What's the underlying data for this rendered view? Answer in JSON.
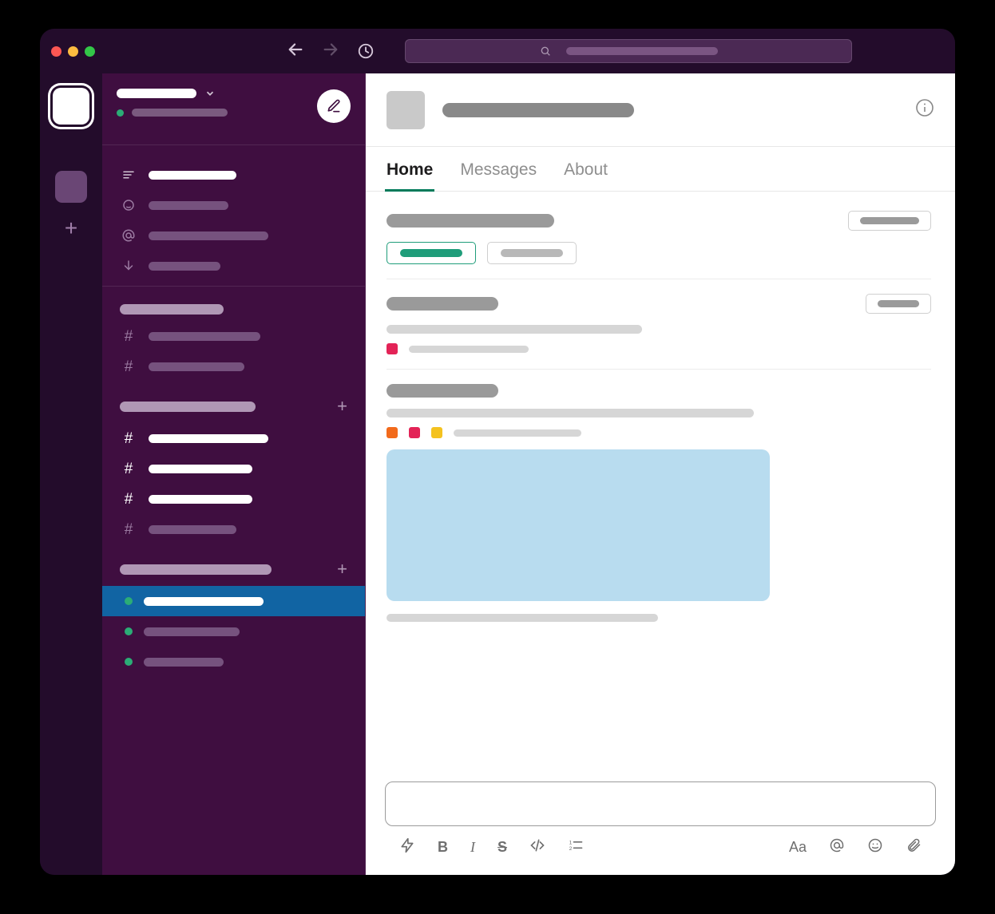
{
  "titlebar": {
    "search_placeholder": ""
  },
  "rail": {
    "add_label": "+"
  },
  "sidebar": {
    "workspace_name": "",
    "status_text": "",
    "top_items": [
      {
        "icon": "threads",
        "label": "",
        "emph": true
      },
      {
        "icon": "dms",
        "label": "",
        "emph": false
      },
      {
        "icon": "mentions",
        "label": "",
        "emph": false
      },
      {
        "icon": "more",
        "label": "",
        "emph": false
      }
    ],
    "sections": [
      {
        "heading": "",
        "add": false,
        "items": [
          {
            "type": "channel",
            "label": "",
            "emph": false
          },
          {
            "type": "channel",
            "label": "",
            "emph": false
          }
        ]
      },
      {
        "heading": "",
        "add": true,
        "items": [
          {
            "type": "channel",
            "label": "",
            "emph": true
          },
          {
            "type": "channel",
            "label": "",
            "emph": true
          },
          {
            "type": "channel",
            "label": "",
            "emph": true
          },
          {
            "type": "channel",
            "label": "",
            "emph": false
          }
        ]
      },
      {
        "heading": "",
        "add": true,
        "items": [
          {
            "type": "dm",
            "label": "",
            "emph": true,
            "active": true
          },
          {
            "type": "dm",
            "label": "",
            "emph": false
          },
          {
            "type": "dm",
            "label": "",
            "emph": false
          }
        ]
      }
    ]
  },
  "main": {
    "header_title": "",
    "tabs": [
      "Home",
      "Messages",
      "About"
    ],
    "active_tab": "Home",
    "sections": [
      {
        "title": "",
        "action": "",
        "chips": [
          {
            "style": "green",
            "label": ""
          },
          {
            "style": "gray",
            "label": ""
          }
        ]
      },
      {
        "title": "",
        "action": "",
        "body_line": "",
        "cal": [
          {
            "color": "#e32357"
          }
        ],
        "cal_label": ""
      },
      {
        "title": "",
        "body_line": "",
        "cal": [
          {
            "color": "#f26a1b"
          },
          {
            "color": "#e32357"
          },
          {
            "color": "#f4c21f"
          }
        ],
        "cal_label": "",
        "card": true,
        "footer_line": ""
      }
    ],
    "composer_placeholder": ""
  },
  "colors": {
    "sidebar_bg": "#3f0e40",
    "titlebar_bg": "#230c2b",
    "active_row": "#1164a3",
    "accent_green": "#007a5a",
    "presence": "#2bac76",
    "card": "#b8dcef"
  }
}
